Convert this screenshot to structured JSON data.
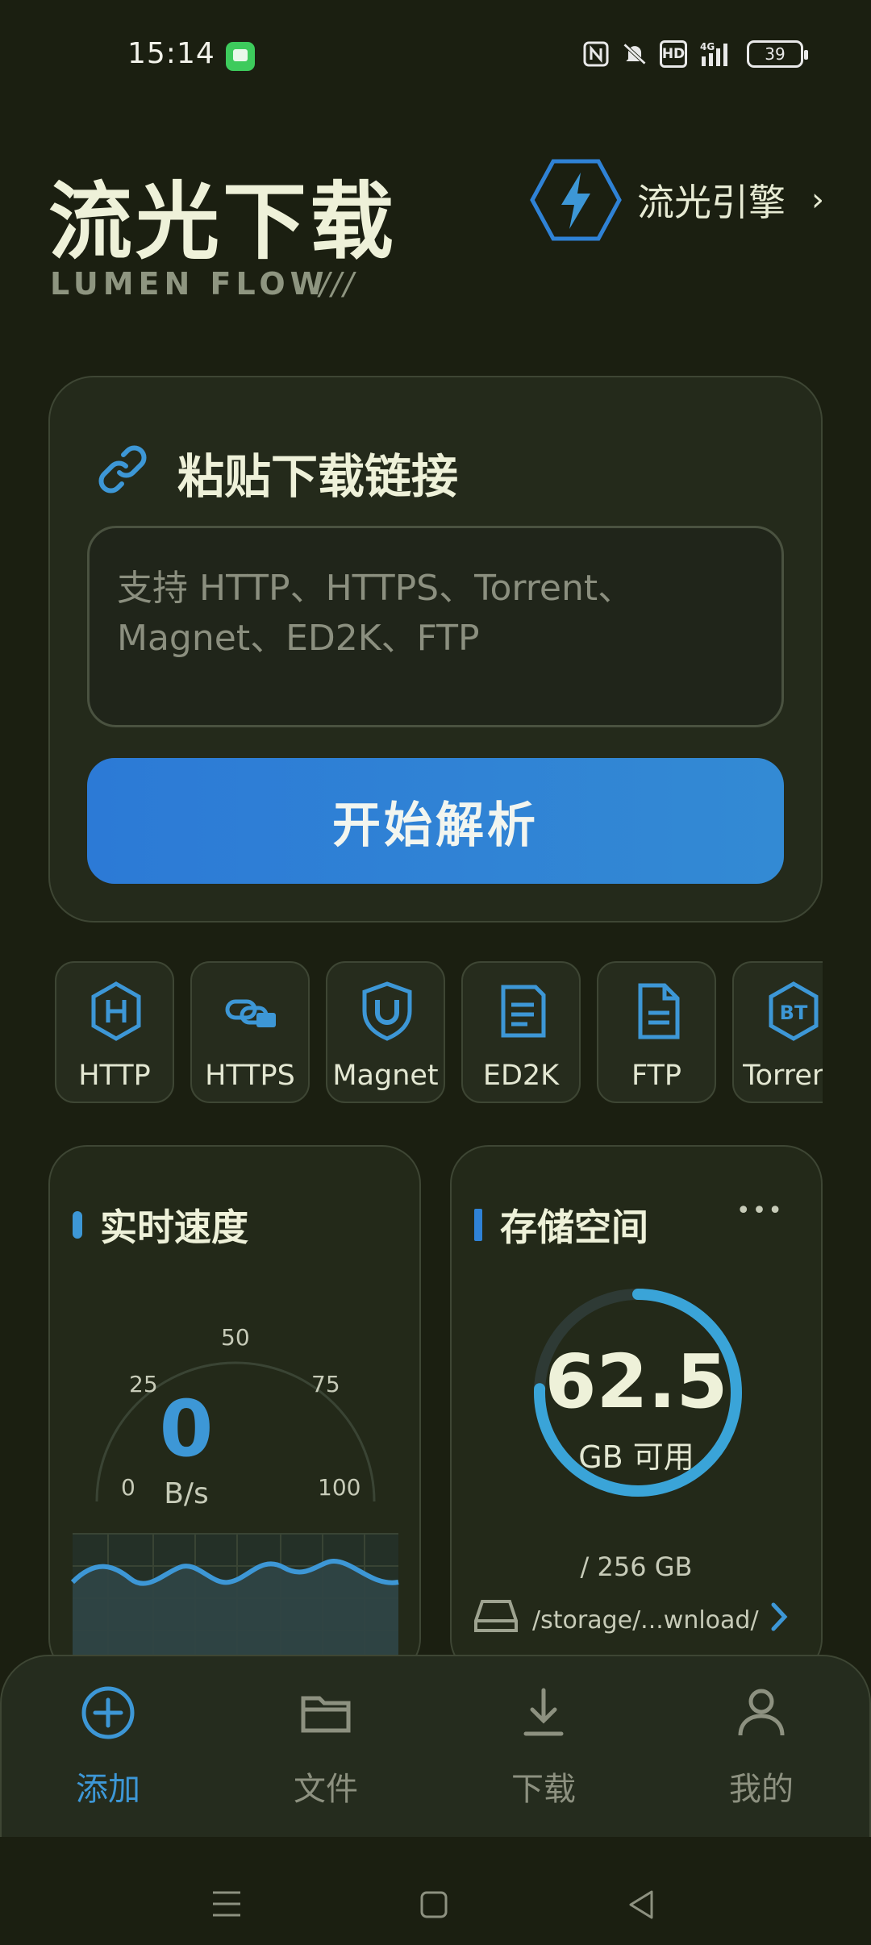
{
  "status_bar": {
    "time": "15:14",
    "hd_label": "HD",
    "network_label": "4G",
    "battery": "39"
  },
  "header": {
    "title": "流光下载",
    "subtitle": "LUMEN FLOW",
    "subtitle_slashes": "///",
    "engine_label": "流光引擎",
    "engine_chevron": "›"
  },
  "paste_card": {
    "title": "粘贴下载链接",
    "placeholder": "支持 HTTP、HTTPS、Torrent、Magnet、ED2K、FTP",
    "parse_button": "开始解析"
  },
  "protocols": [
    {
      "label": "HTTP",
      "icon": "hexagon-h-icon"
    },
    {
      "label": "HTTPS",
      "icon": "link-lock-icon"
    },
    {
      "label": "Magnet",
      "icon": "magnet-shield-icon"
    },
    {
      "label": "ED2K",
      "icon": "document-icon"
    },
    {
      "label": "FTP",
      "icon": "file-icon"
    },
    {
      "label": "Torrent",
      "icon": "hexagon-bt-icon"
    }
  ],
  "speed_card": {
    "title": "实时速度",
    "ticks": [
      "0",
      "25",
      "50",
      "75",
      "100"
    ],
    "value": "0",
    "unit": "B/s"
  },
  "storage_card": {
    "title": "存储空间",
    "more": "•••",
    "value": "62.5",
    "available_label": "GB 可用",
    "total": "/ 256 GB",
    "used_fraction": 0.756,
    "path": "/storage/...wnload/"
  },
  "bottom_nav": [
    {
      "label": "添加",
      "icon": "add-circle-icon",
      "active": true
    },
    {
      "label": "文件",
      "icon": "folder-icon",
      "active": false
    },
    {
      "label": "下载",
      "icon": "download-icon",
      "active": false
    },
    {
      "label": "我的",
      "icon": "person-icon",
      "active": false
    }
  ],
  "colors": {
    "accent": "#3d97d6",
    "background": "#1b1f11",
    "card": "#232919",
    "button": "#2f82d6"
  }
}
